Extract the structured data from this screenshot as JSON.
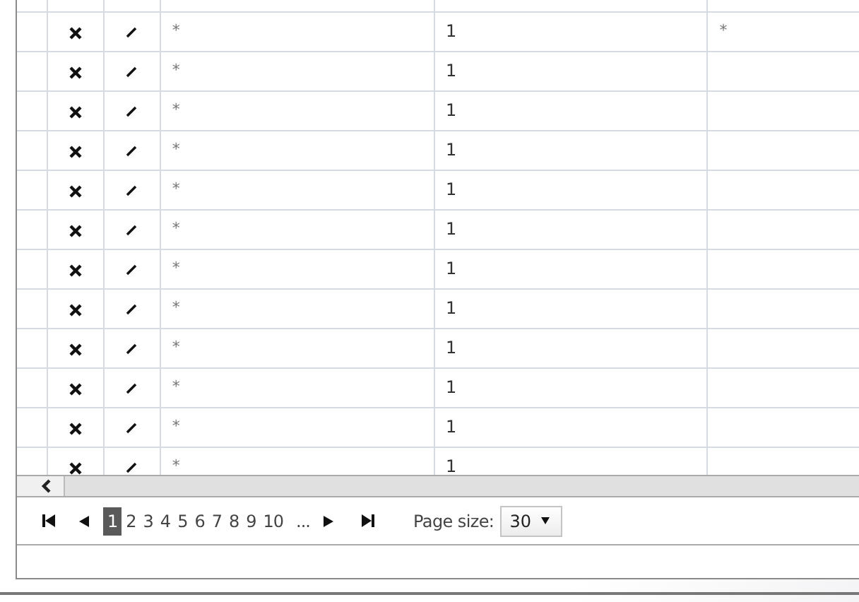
{
  "grid": {
    "rows": [
      {
        "col_3": "*",
        "col_4": "1",
        "col_5": "*"
      },
      {
        "col_3": "*",
        "col_4": "1"
      },
      {
        "col_3": "*",
        "col_4": "1"
      },
      {
        "col_3": "*",
        "col_4": "1"
      },
      {
        "col_3": "*",
        "col_4": "1"
      },
      {
        "col_3": "*",
        "col_4": "1"
      },
      {
        "col_3": "*",
        "col_4": "1"
      },
      {
        "col_3": "*",
        "col_4": "1"
      },
      {
        "col_3": "*",
        "col_4": "1"
      },
      {
        "col_3": "*",
        "col_4": "1"
      },
      {
        "col_3": "*",
        "col_4": "1"
      },
      {
        "col_3": "*",
        "col_4": "1"
      }
    ]
  },
  "pager": {
    "pages": [
      {
        "label": "1",
        "selected": true
      },
      {
        "label": "2",
        "selected": false
      },
      {
        "label": "3",
        "selected": false
      },
      {
        "label": "4",
        "selected": false
      },
      {
        "label": "5",
        "selected": false
      },
      {
        "label": "6",
        "selected": false
      },
      {
        "label": "7",
        "selected": false
      },
      {
        "label": "8",
        "selected": false
      },
      {
        "label": "9",
        "selected": false
      },
      {
        "label": "10",
        "selected": false
      }
    ],
    "more": "...",
    "page_size_label": "Page size:",
    "page_size": "30"
  }
}
